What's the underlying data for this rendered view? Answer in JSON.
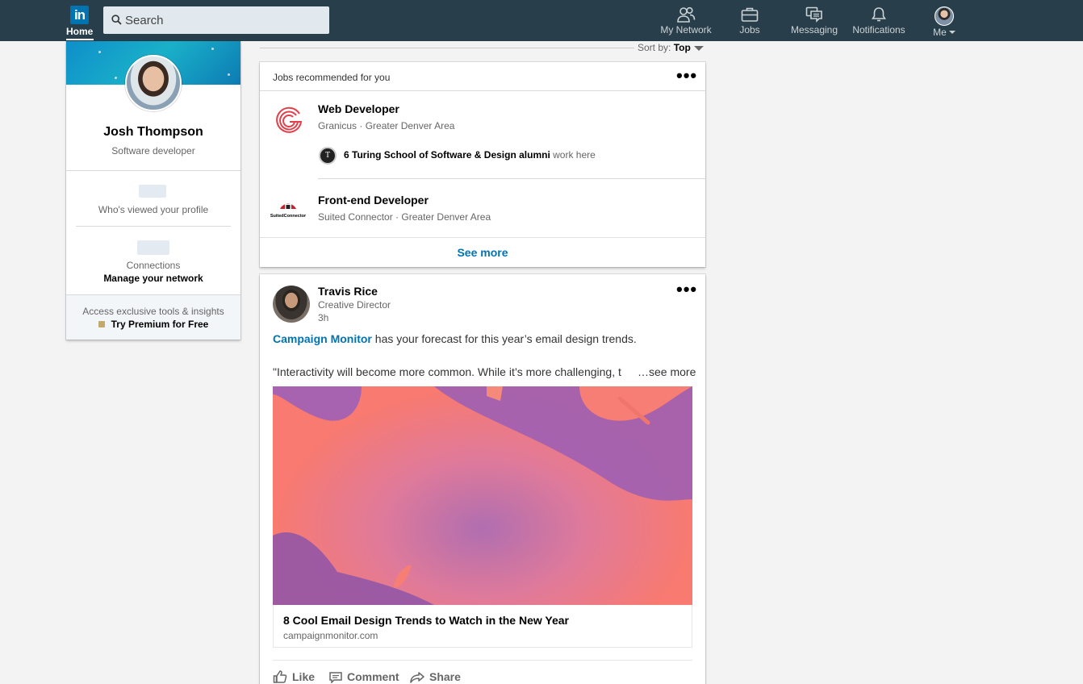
{
  "nav": {
    "logo": "in",
    "home_label": "Home",
    "search_placeholder": "Search",
    "items": [
      {
        "label": "My Network",
        "icon": "network-icon"
      },
      {
        "label": "Jobs",
        "icon": "briefcase-icon"
      },
      {
        "label": "Messaging",
        "icon": "messaging-icon"
      },
      {
        "label": "Notifications",
        "icon": "bell-icon"
      },
      {
        "label": "Me",
        "icon": "avatar"
      }
    ],
    "accent": "#283e4a"
  },
  "profile": {
    "name": "Josh Thompson",
    "headline": "Software developer",
    "viewed_label": "Who's viewed your profile",
    "connections_label": "Connections",
    "connections_sub": "Manage your network",
    "premium_text": "Access exclusive tools & insights",
    "premium_link": "Try Premium for Free"
  },
  "feed": {
    "sort_label": "Sort by:",
    "sort_value": "Top"
  },
  "jobs": {
    "title": "Jobs recommended for you",
    "items": [
      {
        "title": "Web Developer",
        "company": "Granicus",
        "location": "Greater Denver Area",
        "alumni_bold": "6 Turing School of Software & Design alumni",
        "alumni_rest": "work here"
      },
      {
        "title": "Front-end Developer",
        "company": "Suited Connector",
        "location": "Greater Denver Area",
        "logo_text": "SuitedConnector"
      }
    ],
    "see_more": "See more"
  },
  "post": {
    "author": "Travis Rice",
    "author_title": "Creative Director",
    "time": "3h",
    "mention": "Campaign Monitor",
    "text1_rest": "has your forecast for this year’s email design trends.",
    "text2": "\"Interactivity will become more common. While it’s more challenging, t",
    "see_more": "…see more",
    "article_title": "8 Cool Email Design Trends to Watch in the New Year",
    "article_domain": "campaignmonitor.com",
    "actions": [
      "Like",
      "Comment",
      "Share"
    ],
    "link_color": "#0073b1"
  }
}
